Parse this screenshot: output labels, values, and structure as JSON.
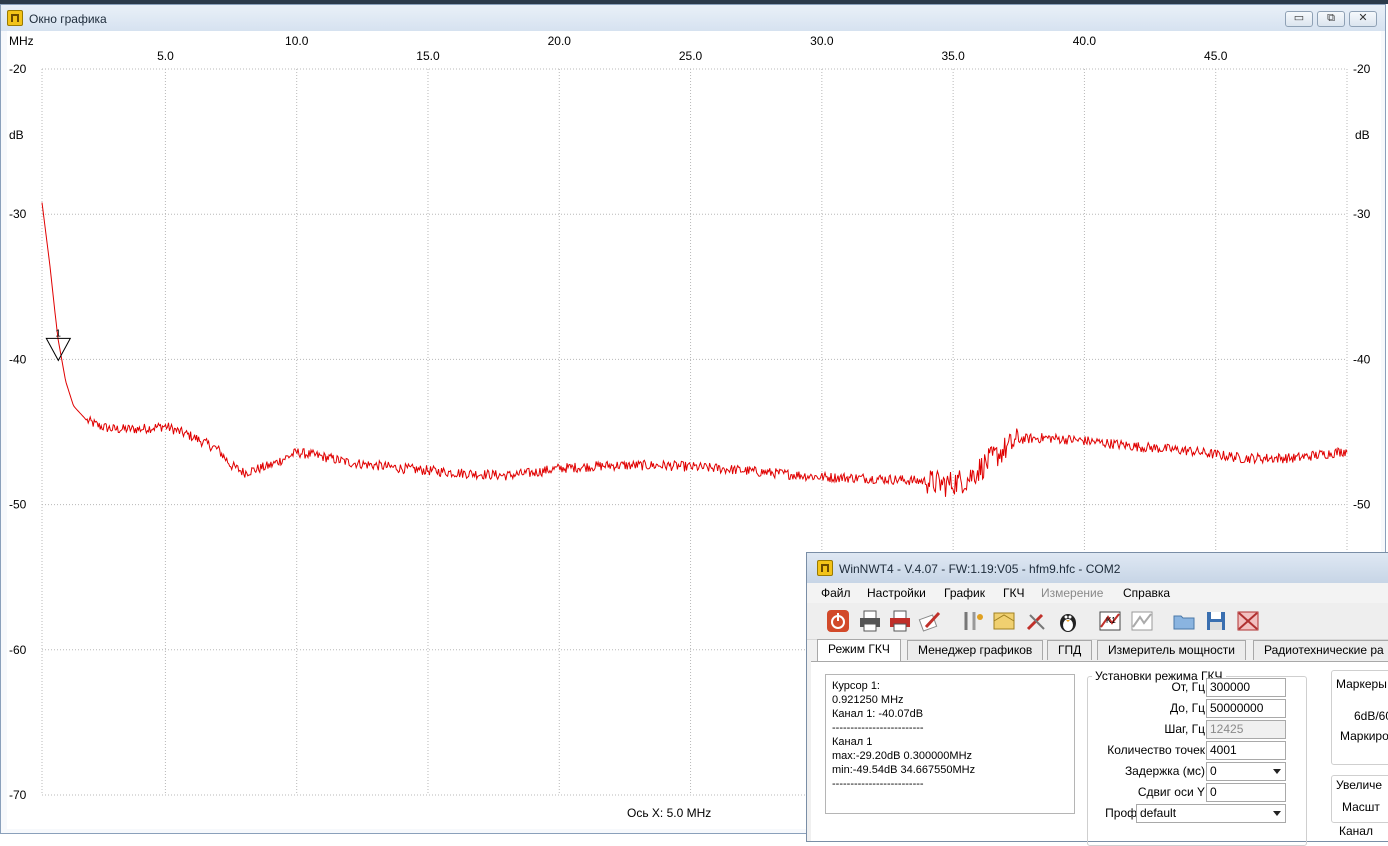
{
  "graph_window": {
    "title": "Окно графика",
    "controls": {
      "minimize": "▭",
      "maximize": "⧉",
      "close": "✕"
    }
  },
  "graph": {
    "x_unit": "MHz",
    "y_unit": "dB",
    "x_footer": "Ось X: 5.0 MHz",
    "marker_label": "1",
    "trace_color": "#e00000",
    "grid_color": "#b8b8b8"
  },
  "chart_data": {
    "type": "line",
    "title": "",
    "xlabel": "MHz",
    "ylabel": "dB",
    "xlim": [
      0.3,
      50.0
    ],
    "ylim": [
      -70,
      -20
    ],
    "x_ticks": [
      "5.0",
      "10.0",
      "15.0",
      "20.0",
      "25.0",
      "30.0",
      "35.0",
      "40.0",
      "45.0"
    ],
    "y_ticks": [
      "-20",
      "-30",
      "-40",
      "-50",
      "-60",
      "-70"
    ],
    "grid": true,
    "series": [
      {
        "color": "#e00000",
        "x": [
          0.3,
          0.6,
          0.9,
          1.2,
          1.5,
          2.0,
          2.5,
          3.0,
          4.0,
          5.0,
          6.0,
          7.0,
          7.5,
          8.0,
          9.0,
          10.0,
          11.0,
          12.0,
          14.0,
          16.0,
          18.0,
          19.0,
          20.0,
          22.0,
          24.0,
          26.0,
          28.0,
          30.0,
          32.0,
          34.0,
          34.7,
          35.5,
          36.5,
          37.5,
          38.5,
          40.0,
          42.0,
          44.0,
          46.0,
          48.0,
          50.0
        ],
        "y": [
          -29.2,
          -33.5,
          -38.5,
          -41.5,
          -43.2,
          -44.2,
          -44.6,
          -44.8,
          -44.8,
          -44.6,
          -45.3,
          -46.2,
          -47.3,
          -47.8,
          -47.3,
          -46.4,
          -46.7,
          -47.1,
          -47.5,
          -47.8,
          -48.0,
          -47.8,
          -47.5,
          -47.3,
          -47.3,
          -47.5,
          -47.8,
          -48.1,
          -48.2,
          -48.4,
          -48.6,
          -48.3,
          -46.8,
          -45.5,
          -45.4,
          -45.6,
          -46.0,
          -46.3,
          -46.8,
          -46.8,
          -46.3
        ]
      }
    ],
    "marker": {
      "label": "1",
      "x": 0.92125,
      "y": -40.07
    }
  },
  "nwt_window": {
    "title": "WinNWT4 - V.4.07 - FW:1.19:V05 - hfm9.hfc - COM2",
    "menu": [
      "Файл",
      "Настройки",
      "График",
      "ГКЧ",
      "Измерение",
      "Справка"
    ],
    "menu_disabled_index": 4,
    "toolbar_icons": [
      "power-icon",
      "print-icon",
      "print-color-icon",
      "edit-icon",
      "tools-icon",
      "map-icon",
      "wand-icon",
      "linux-penguin-icon",
      "k1-calibration-icon",
      "k2-calibration-icon",
      "open-folder-icon",
      "save-icon",
      "close-file-icon"
    ],
    "tabs": [
      "Режим ГКЧ",
      "Менеджер графиков",
      "ГПД",
      "Измеритель мощности",
      "Радиотехнические ра"
    ],
    "info_lines": [
      "Курсор 1:",
      "0.921250 MHz",
      "Канал 1:  -40.07dB",
      "-------------------------",
      "Канал 1",
      "max:-29.20dB 0.300000MHz",
      "min:-49.54dB 34.667550MHz",
      "-------------------------"
    ],
    "settings": {
      "group_title": "Установки режима ГКЧ",
      "from_label": "От, Гц",
      "from_value": "300000",
      "to_label": "До, Гц",
      "to_value": "50000000",
      "step_label": "Шаг, Гц",
      "step_value": "12425",
      "points_label": "Количество точек",
      "points_value": "4001",
      "delay_label": "Задержка (мс)",
      "delay_value": "0",
      "yshift_label": "Сдвиг оси Y",
      "yshift_value": "0",
      "profile_label": "Проф",
      "profile_value": "default"
    },
    "side": {
      "markers_title": "Маркеры",
      "db_text": "6dB/60",
      "marker_text": "Маркиро",
      "zoom_title": "Увеличе",
      "scale_text": "Масшт",
      "channel_text": "Канал"
    }
  }
}
